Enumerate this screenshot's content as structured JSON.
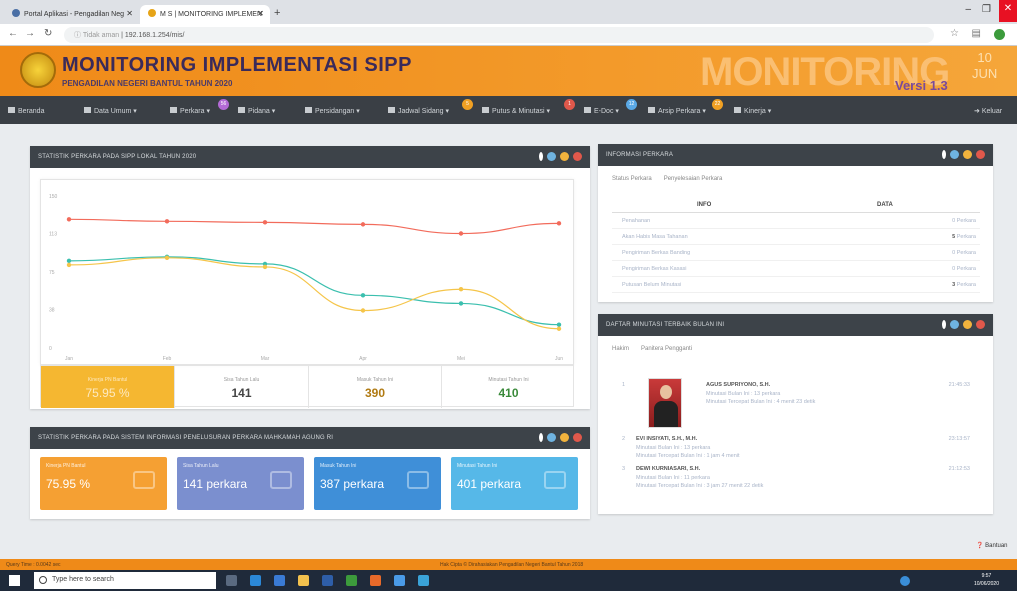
{
  "browser": {
    "tabs": [
      {
        "title": "Portal Aplikasi - Pengadilan Neg"
      },
      {
        "title": "M S | MONITORING IMPLEMEN"
      }
    ],
    "url_security": "Tidak aman",
    "url": "192.168.1.254/mis/"
  },
  "header": {
    "title": "MONITORING IMPLEMENTASI SIPP",
    "subtitle": "PENGADILAN NEGERI BANTUL TAHUN 2020",
    "watermark": "MONITORING",
    "version": "Versi 1.3",
    "date_day": "10",
    "date_month": "JUN"
  },
  "menu": {
    "items": [
      {
        "label": "Beranda"
      },
      {
        "label": "Data Umum"
      },
      {
        "label": "Perkara"
      },
      {
        "label": "Pidana"
      },
      {
        "label": "Persidangan"
      },
      {
        "label": "Jadwal Sidang"
      },
      {
        "label": "Putus & Minutasi"
      },
      {
        "label": "E-Doc"
      },
      {
        "label": "Arsip Perkara"
      },
      {
        "label": "Kinerja"
      }
    ],
    "logout": "Keluar",
    "badges": [
      {
        "text": "56",
        "color": "#b36ad6"
      },
      {
        "text": "5",
        "color": "#f0a023"
      },
      {
        "text": "1",
        "color": "#e0584b"
      },
      {
        "text": "12",
        "color": "#5aa9e6"
      },
      {
        "text": "22",
        "color": "#f0a023"
      }
    ]
  },
  "panel_stat": {
    "title": "STATISTIK PERKARA PADA SIPP LOKAL TAHUN 2020",
    "stats": [
      {
        "label": "Kinerja PN Bantul",
        "value": "75.95 %"
      },
      {
        "label": "Sisa Tahun Lalu",
        "value": "141",
        "color": "#444444"
      },
      {
        "label": "Masuk Tahun Ini",
        "value": "390",
        "color": "#b07a12"
      },
      {
        "label": "Minutasi Tahun Ini",
        "value": "410",
        "color": "#3a8a3a"
      }
    ]
  },
  "chart_data": {
    "type": "line",
    "categories": [
      "Jan",
      "Feb",
      "Mar",
      "Apr",
      "Mei",
      "Jun"
    ],
    "yticks": [
      "0",
      "38",
      "75",
      "113",
      "150"
    ],
    "ylim": [
      0,
      150
    ],
    "grid": false,
    "series": [
      {
        "color": "#f26b5b",
        "values": [
          127,
          125,
          124,
          122,
          113,
          123
        ]
      },
      {
        "color": "#3bbfae",
        "values": [
          86,
          90,
          83,
          52,
          44,
          23
        ]
      },
      {
        "color": "#f5c54a",
        "values": [
          82,
          89,
          80,
          37,
          58,
          19
        ]
      }
    ]
  },
  "panel_mari": {
    "title": "STATISTIK PERKARA PADA SISTEM INFORMASI PENELUSURAN PERKARA MAHKAMAH AGUNG RI",
    "cards": [
      {
        "label": "Kinerja PN Bantul",
        "value": "75.95 %",
        "color": "#f5a033"
      },
      {
        "label": "Sisa Tahun Lalu",
        "value": "141 perkara",
        "color": "#7b8fcf"
      },
      {
        "label": "Masuk Tahun Ini",
        "value": "387 perkara",
        "color": "#3f8fd8"
      },
      {
        "label": "Minutasi Tahun Ini",
        "value": "401 perkara",
        "color": "#56b8e8"
      }
    ]
  },
  "panel_info": {
    "title": "INFORMASI PERKARA",
    "tabs": [
      "Status Perkara",
      "Penyelesaian Perkara"
    ],
    "col_info": "INFO",
    "col_data": "DATA",
    "rows": [
      {
        "key": "Penahanan",
        "num": "",
        "unit": "0 Perkara"
      },
      {
        "key": "Akan Habis Masa Tahanan",
        "num": "5",
        "unit": "Perkara"
      },
      {
        "key": "Pengiriman Berkas Banding",
        "num": "",
        "unit": "0 Perkara"
      },
      {
        "key": "Pengiriman Berkas Kasasi",
        "num": "",
        "unit": "0 Perkara"
      },
      {
        "key": "Putusan Belum Minutasi",
        "num": "3",
        "unit": "Perkara"
      }
    ]
  },
  "panel_minutasi": {
    "title": "DAFTAR MINUTASI TERBAIK BULAN INI",
    "tabs": [
      "Hakim",
      "Panitera Pengganti"
    ],
    "rows": [
      {
        "no": "1",
        "name": "AGUS SUPRIYONO, S.H.",
        "l1": "Minutasi Bulan Ini : 13 perkara",
        "l2": "Minutasi Tercepat Bulan Ini : 4 menit 23 detik",
        "time": "21:45:33"
      },
      {
        "no": "2",
        "name": "EVI INSIYATI, S.H., M.H.",
        "l1": "Minutasi Bulan Ini : 13 perkara",
        "l2": "Minutasi Tercepat Bulan Ini : 1 jam 4 menit",
        "time": "23:13:57"
      },
      {
        "no": "3",
        "name": "DEWI KURNIASARI, S.H.",
        "l1": "Minutasi Bulan Ini : 11 perkara",
        "l2": "Minutasi Tercepat Bulan Ini : 3 jam 27 menit 22 detik",
        "time": "21:12:53"
      }
    ]
  },
  "help": "Bantuan",
  "footer": {
    "query": "Query Time : 0.0042 sec",
    "copy": "Hak Cipta © Dirahasiakan Pengadilan Negeri Bantul Tahun 2018"
  },
  "taskbar": {
    "search": "Type here to search",
    "time": "9:57",
    "date": "10/06/2020"
  }
}
